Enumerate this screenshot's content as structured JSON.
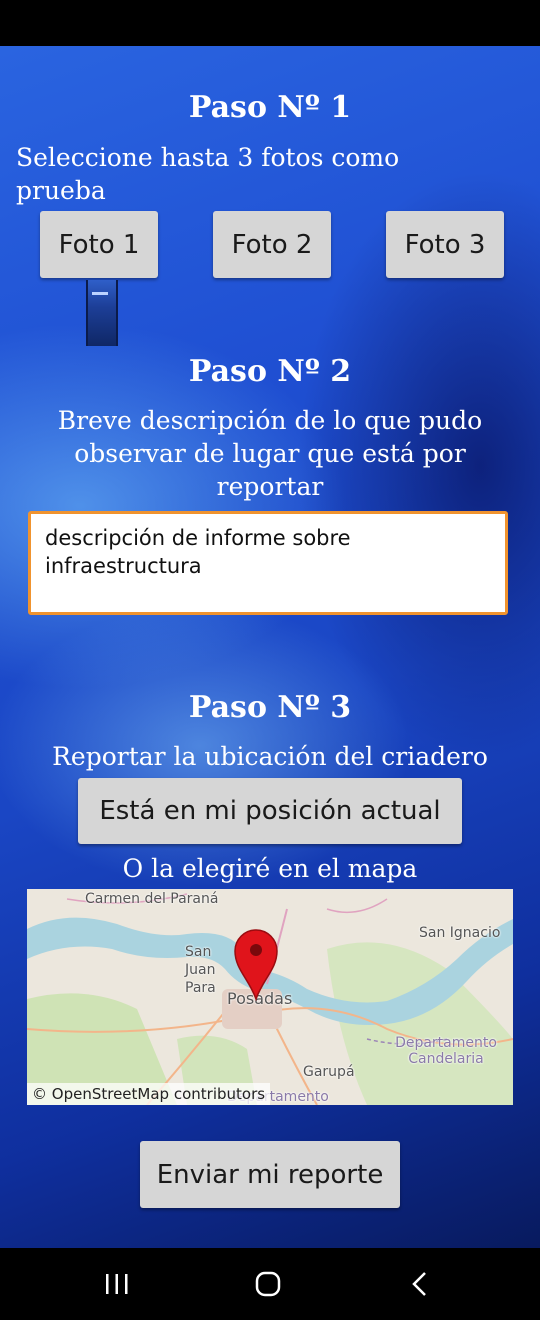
{
  "step1": {
    "heading": "Paso Nº 1",
    "instruction": "Seleccione hasta 3 fotos como prueba",
    "buttons": [
      "Foto 1",
      "Foto 2",
      "Foto 3"
    ]
  },
  "step2": {
    "heading": "Paso Nº 2",
    "instruction": "Breve descripción de lo que pudo observar de lugar que está por reportar",
    "description_value": "descripción de informe sobre infraestructura"
  },
  "step3": {
    "heading": "Paso Nº 3",
    "instruction": "Reportar la ubicación del criadero",
    "current_position_button": "Está en mi posición actual",
    "map_prompt": "O la elegiré en el mapa"
  },
  "map": {
    "labels": {
      "carmen": "Carmen del Paraná",
      "san_ignacio": "San Ignacio",
      "san_juan": "San Juan Para",
      "posadas": "Posadas",
      "candelaria": "Departamento Candelaria",
      "garupa": "Garupá",
      "departamento_bottom": "Departamento"
    },
    "attribution": "© OpenStreetMap contributors",
    "marker_icon": "location-pin-icon"
  },
  "submit_button": "Enviar mi reporte",
  "colors": {
    "button_bg": "#d6d6d6",
    "textarea_border": "#f0932e",
    "marker": "#e0141b",
    "water": "#aad3df"
  }
}
